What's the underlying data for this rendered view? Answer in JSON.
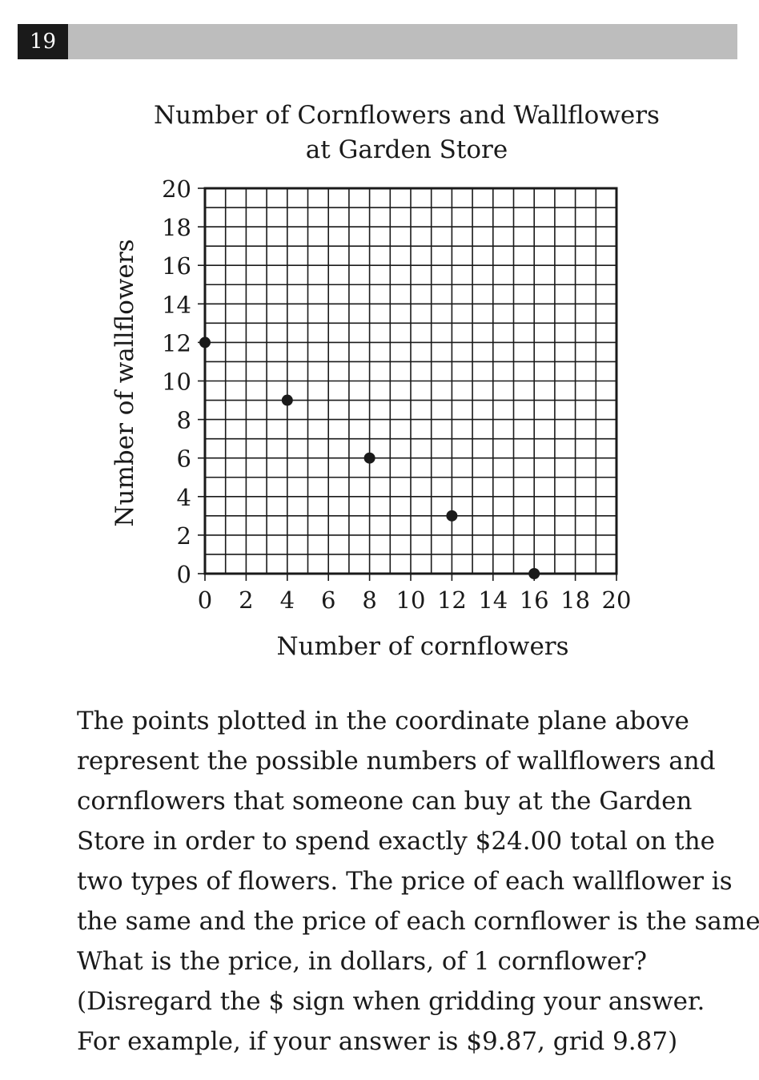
{
  "question_number": "19",
  "chart_data": {
    "type": "scatter",
    "title_lines": [
      "Number of Cornflowers and Wallflowers",
      "at Garden Store"
    ],
    "xlabel": "Number of cornflowers",
    "ylabel": "Number of wallflowers",
    "xlim": [
      0,
      20
    ],
    "ylim": [
      0,
      20
    ],
    "x_ticks": [
      0,
      2,
      4,
      6,
      8,
      10,
      12,
      14,
      16,
      18,
      20
    ],
    "y_ticks": [
      0,
      2,
      4,
      6,
      8,
      10,
      12,
      14,
      16,
      18,
      20
    ],
    "grid": true,
    "grid_step": 1,
    "points": [
      {
        "x": 0,
        "y": 12
      },
      {
        "x": 4,
        "y": 9
      },
      {
        "x": 8,
        "y": 6
      },
      {
        "x": 12,
        "y": 3
      },
      {
        "x": 16,
        "y": 0
      }
    ],
    "point_color": "#1a1a1a"
  },
  "question_lines": [
    "The points plotted in the coordinate plane above",
    "represent the possible numbers of wallflowers and",
    "cornflowers that someone can buy at the Garden",
    "Store in order to spend exactly $24.00 total on the",
    "two types of flowers. The price of each wallflower is",
    "the same and the price of each cornflower is the same.",
    "What is the price, in dollars, of 1 cornflower?",
    "(Disregard the $ sign when gridding your answer.",
    "For example, if your answer is $9.87, grid 9.87)"
  ]
}
